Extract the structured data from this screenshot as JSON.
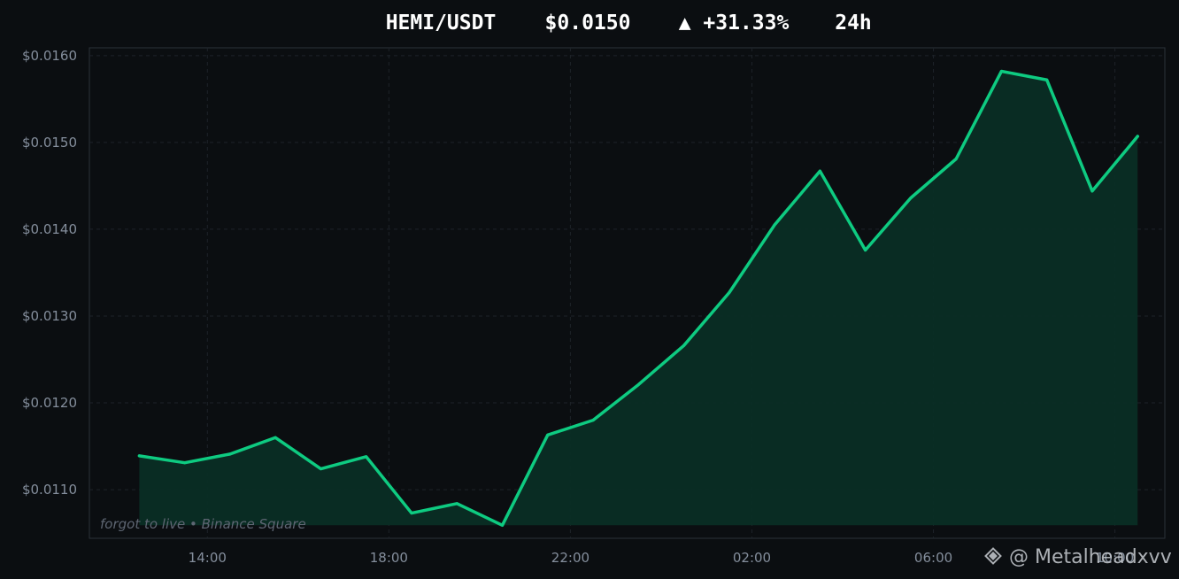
{
  "header": {
    "pair": "HEMI/USDT",
    "price": "$0.0150",
    "change": "▲ +31.33%",
    "period": "24h"
  },
  "source_label": "forgot to live  •  Binance Square",
  "watermark": {
    "icon": "binance-logo-icon",
    "handle": "@ Metalheadxvv"
  },
  "colors": {
    "background": "#0b0e11",
    "line": "#0ecb81",
    "fill": "#0a2e25",
    "grid": "#1e2329",
    "tick_text": "#848e9c"
  },
  "chart_data": {
    "type": "area",
    "title": "HEMI/USDT",
    "xlabel": "",
    "ylabel": "",
    "x_tick_labels": [
      "14:00",
      "18:00",
      "22:00",
      "02:00",
      "06:00",
      "10:00"
    ],
    "y_tick_labels": [
      "$0.0110",
      "$0.0120",
      "$0.0130",
      "$0.0140",
      "$0.0150",
      "$0.0160"
    ],
    "y_ticks": [
      0.011,
      0.012,
      0.013,
      0.014,
      0.015,
      0.016
    ],
    "ylim": [
      0.01044,
      0.01609
    ],
    "xlim": [
      11.4,
      35.1
    ],
    "fill_baseline": 0.01059,
    "grid": true,
    "series": [
      {
        "x": [
          12.5,
          13.5,
          14.5,
          15.5,
          16.5,
          17.5,
          18.5,
          19.5,
          20.5,
          21.5,
          22.5,
          23.5,
          24.5,
          25.5,
          26.5,
          27.5,
          28.5,
          29.5,
          30.5,
          31.5,
          32.5,
          33.5,
          34.5
        ],
        "y": [
          0.01139,
          0.01131,
          0.01141,
          0.0116,
          0.01124,
          0.01138,
          0.01073,
          0.01084,
          0.01059,
          0.01163,
          0.0118,
          0.01221,
          0.01266,
          0.01327,
          0.01405,
          0.01467,
          0.01376,
          0.01436,
          0.01481,
          0.01582,
          0.01572,
          0.01444,
          0.01507
        ]
      }
    ]
  }
}
